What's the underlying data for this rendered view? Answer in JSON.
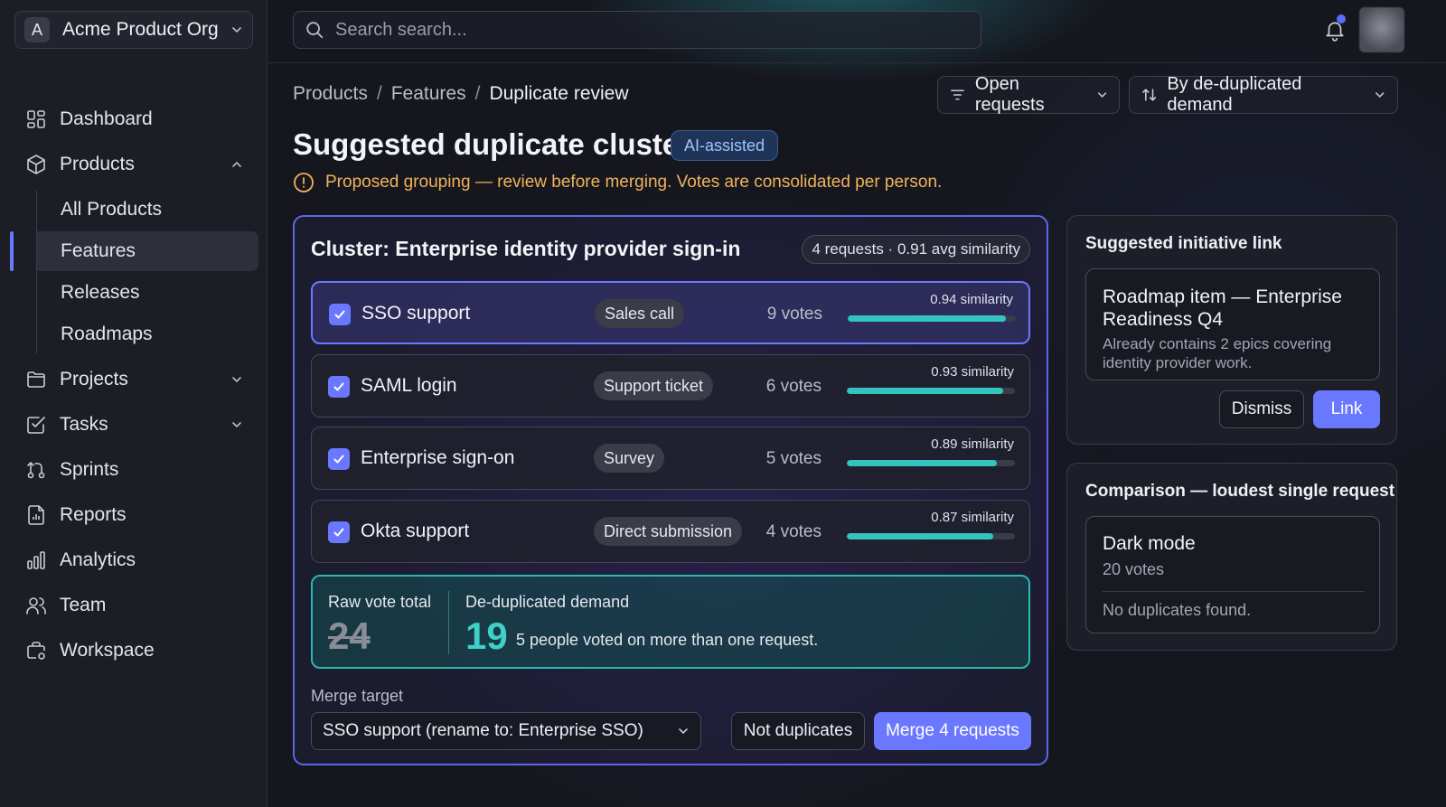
{
  "org": {
    "initial": "A",
    "name": "Acme Product Org"
  },
  "sidebar": {
    "items": [
      {
        "label": "Dashboard"
      },
      {
        "label": "Products"
      },
      {
        "label": "Projects"
      },
      {
        "label": "Tasks"
      },
      {
        "label": "Sprints"
      },
      {
        "label": "Reports"
      },
      {
        "label": "Analytics"
      },
      {
        "label": "Team"
      },
      {
        "label": "Workspace"
      }
    ],
    "products_sub": [
      "All Products",
      "Features",
      "Releases",
      "Roadmaps"
    ]
  },
  "search": {
    "placeholder": "Search search..."
  },
  "breadcrumb": [
    "Products",
    "Features",
    "Duplicate review"
  ],
  "filters": {
    "status": "Open requests",
    "sort": "By de-duplicated demand"
  },
  "page": {
    "title": "Suggested duplicate cluster",
    "badge": "AI-assisted",
    "warning": "Proposed grouping — review before merging. Votes are consolidated per person."
  },
  "cluster": {
    "title": "Cluster: Enterprise identity provider sign-in",
    "meta": "4 requests · 0.91 avg similarity",
    "requests": [
      {
        "title": "SSO support",
        "source": "Sales call",
        "votes": "9 votes",
        "similarity_label": "0.94 similarity",
        "similarity": 0.94
      },
      {
        "title": "SAML login",
        "source": "Support ticket",
        "votes": "6 votes",
        "similarity_label": "0.93 similarity",
        "similarity": 0.93
      },
      {
        "title": "Enterprise sign-on",
        "source": "Survey",
        "votes": "5 votes",
        "similarity_label": "0.89 similarity",
        "similarity": 0.89
      },
      {
        "title": "Okta support",
        "source": "Direct submission",
        "votes": "4 votes",
        "similarity_label": "0.87 similarity",
        "similarity": 0.87
      }
    ],
    "raw_label": "Raw vote total",
    "raw_value": "24",
    "dedup_label": "De-duplicated demand",
    "dedup_value": "19",
    "dedup_note": "5 people voted on more than one request.",
    "merge_label": "Merge target",
    "merge_value": "SSO support (rename to: Enterprise SSO)",
    "not_dup_label": "Not duplicates",
    "merge_btn_label": "Merge 4 requests"
  },
  "initiative": {
    "title": "Suggested initiative link",
    "item_title": "Roadmap item — Enterprise Readiness Q4",
    "item_desc": "Already contains 2 epics covering identity provider work.",
    "dismiss_label": "Dismiss",
    "link_label": "Link"
  },
  "comparison": {
    "title": "Comparison — loudest single request",
    "item_title": "Dark mode",
    "item_votes": "20 votes",
    "item_note": "No duplicates found."
  },
  "colors": {
    "accent": "#6a78ff",
    "teal": "#33c4c0",
    "warning": "#f0b25a"
  }
}
